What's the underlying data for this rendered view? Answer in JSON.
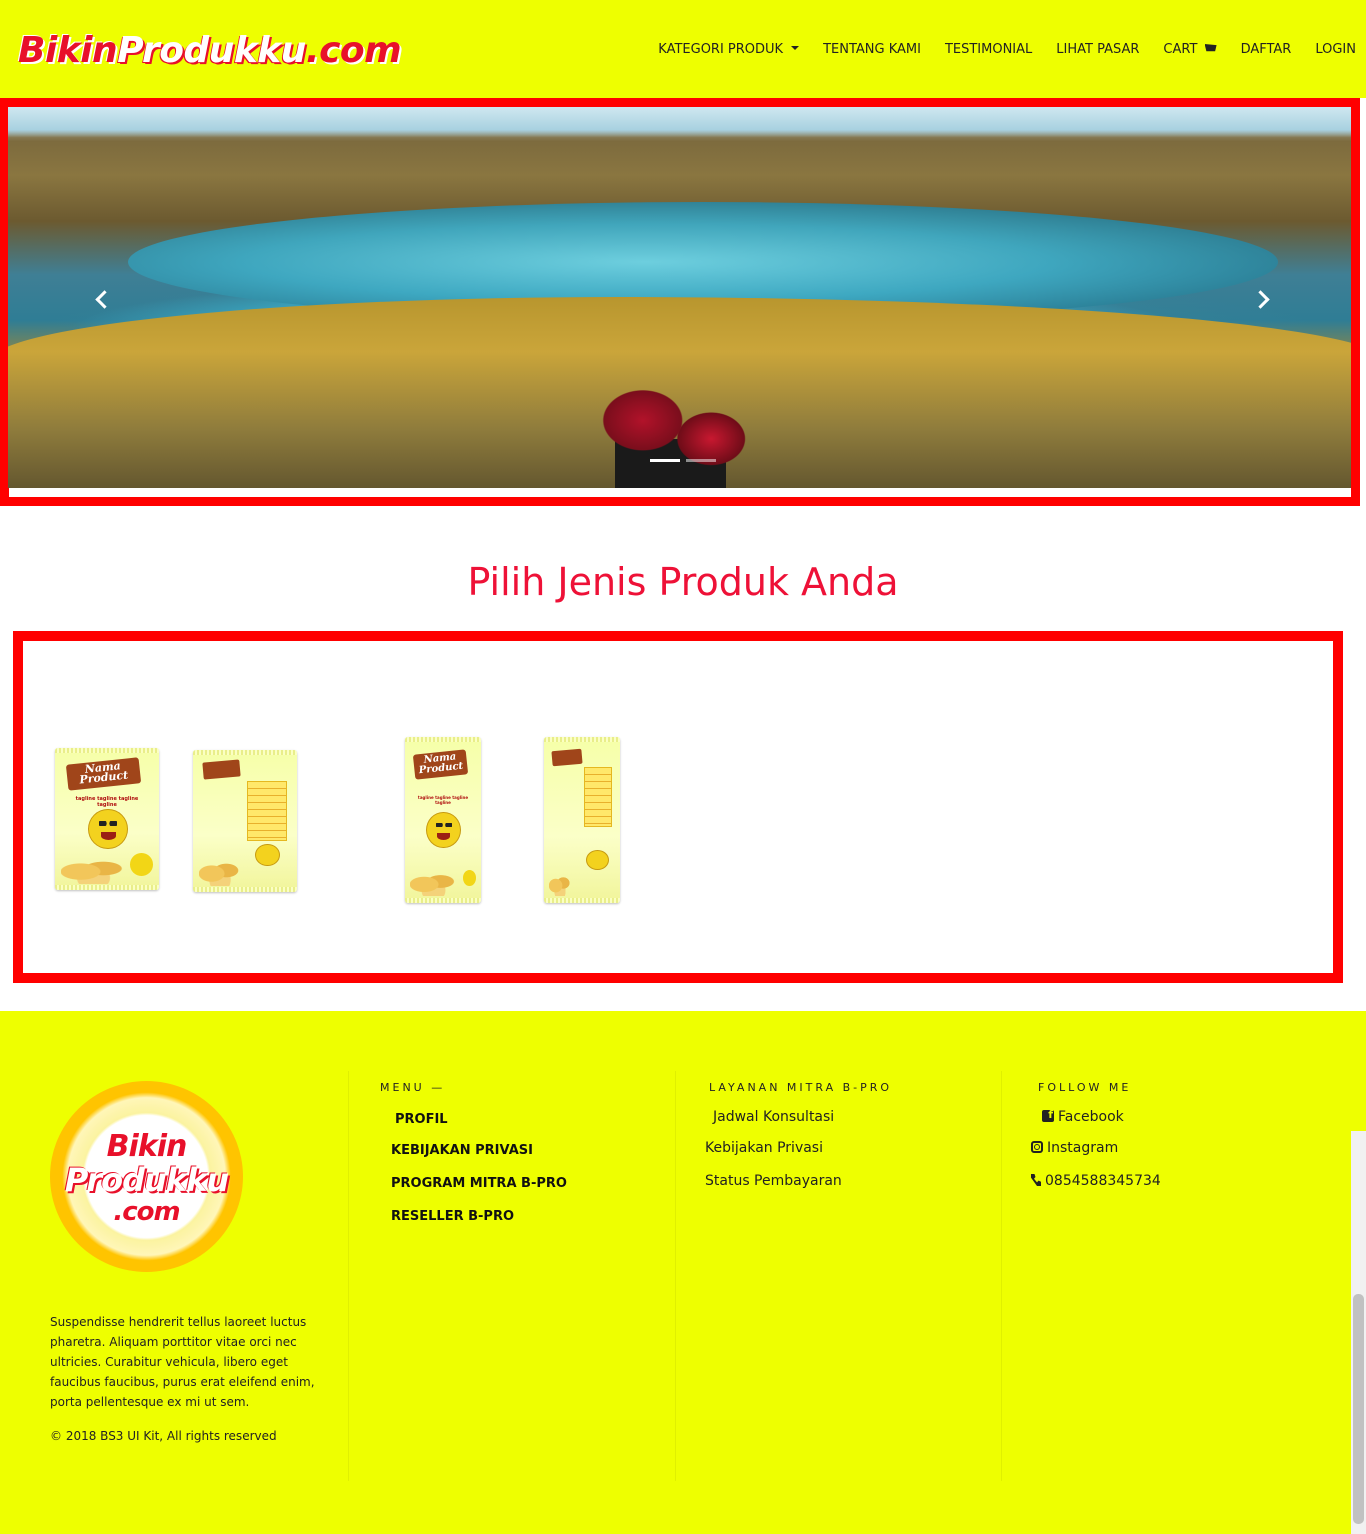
{
  "navbar": {
    "logo": {
      "part1": "Bikin",
      "part2": "Produkku",
      "part3": ".com"
    },
    "items": [
      {
        "label": "KATEGORI PRODUK",
        "dropdown": true
      },
      {
        "label": "TENTANG KAMI"
      },
      {
        "label": "TESTIMONIAL"
      },
      {
        "label": "LIHAT PASAR"
      },
      {
        "label": "CART",
        "icon": "cart-icon"
      },
      {
        "label": "DAFTAR"
      },
      {
        "label": "LOGIN"
      }
    ]
  },
  "hero": {
    "image": "lake-landscape-with-sneakers",
    "indicators": 2,
    "active_indicator": 1
  },
  "products": {
    "title": "Pilih Jenis Produk Anda",
    "items": [
      {
        "name": "standing-pouch-front",
        "label": "Nama Product",
        "tagline": "tagline tagline tagline tagline"
      },
      {
        "name": "standing-pouch-back"
      },
      {
        "name": "slim-pouch-front",
        "label": "Nama Product",
        "tagline": "tagline tagline tagline tagline"
      },
      {
        "name": "slim-pouch-back"
      }
    ]
  },
  "footer": {
    "logo": {
      "line1": "Bikin",
      "line2": "Produkku",
      "line3": ".com"
    },
    "description": "Suspendisse hendrerit tellus laoreet luctus pharetra. Aliquam porttitor vitae orci nec ultricies. Curabitur vehicula, libero eget faucibus faucibus, purus erat eleifend enim, porta pellentesque ex mi ut sem.",
    "copyright": "© 2018 BS3 UI Kit, All rights reserved",
    "menu": {
      "heading": "MENU —",
      "links": [
        "PROFIL",
        "KEBIJAKAN PRIVASI",
        "PROGRAM MITRA B-PRO",
        "RESELLER B-PRO"
      ]
    },
    "layanan": {
      "heading": "LAYANAN MITRA B-PRO",
      "links": [
        "Jadwal Konsultasi",
        "Kebijakan Privasi",
        "Status Pembayaran"
      ]
    },
    "follow": {
      "heading": "FOLLOW ME",
      "facebook": "Facebook",
      "instagram": "Instagram",
      "phone": "0854588345734"
    }
  },
  "colors": {
    "brand_yellow": "#eeff00",
    "brand_red": "#ee1137",
    "frame_red": "#ff0000"
  }
}
